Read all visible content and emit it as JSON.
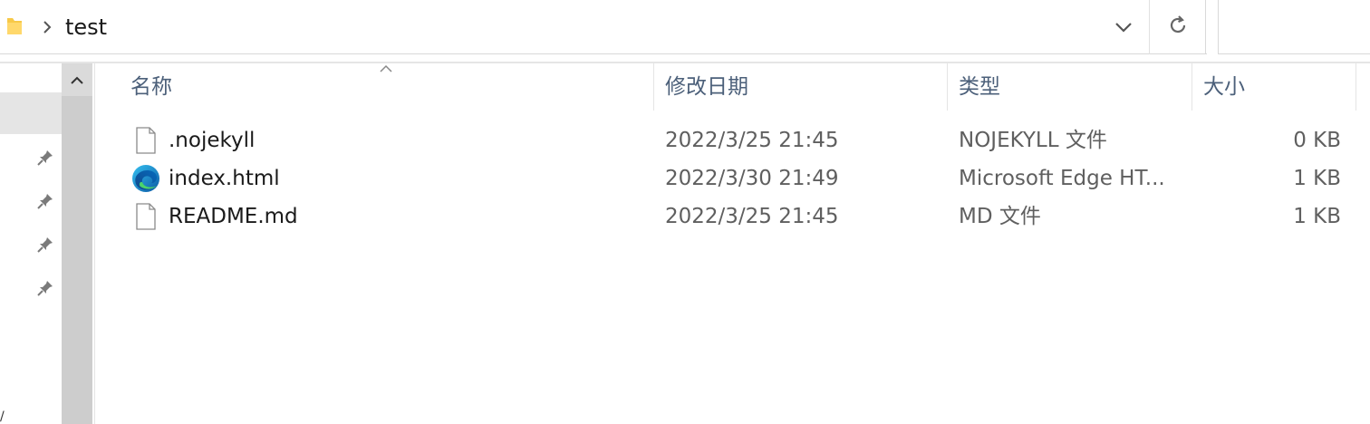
{
  "address_bar": {
    "path": [
      "test"
    ],
    "icons": {
      "folder": "folder-icon",
      "separator": "chevron-right-icon",
      "dropdown": "chevron-down-icon",
      "refresh": "refresh-icon"
    }
  },
  "nav_pane": {
    "pins": [
      "pin-icon",
      "pin-icon",
      "pin-icon",
      "pin-icon"
    ],
    "stray_glyph": "/"
  },
  "columns": {
    "name": "名称",
    "date": "修改日期",
    "type": "类型",
    "size": "大小"
  },
  "files": [
    {
      "name": ".nojekyll",
      "date": "2022/3/25 21:45",
      "type": "NOJEKYLL 文件",
      "size": "0 KB",
      "icon": "blank-file-icon"
    },
    {
      "name": "index.html",
      "date": "2022/3/30 21:49",
      "type": "Microsoft Edge HT...",
      "size": "1 KB",
      "icon": "edge-icon"
    },
    {
      "name": "README.md",
      "date": "2022/3/25 21:45",
      "type": "MD 文件",
      "size": "1 KB",
      "icon": "blank-file-icon"
    }
  ],
  "colors": {
    "header_text": "#4c607a",
    "detail_text": "#5f5f5f",
    "selection": "#e5e5e5",
    "folder_yellow": "#f7c948"
  }
}
